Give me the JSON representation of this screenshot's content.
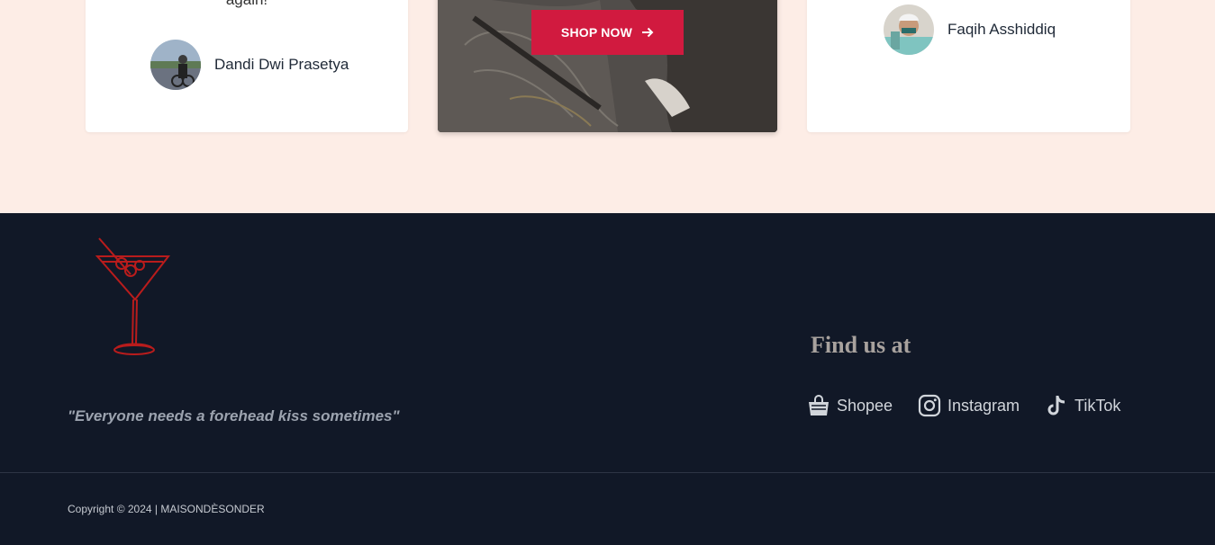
{
  "testimonials": {
    "left": {
      "text_tail": "again!",
      "author": "Dandi Dwi Prasetya"
    },
    "right": {
      "author": "Faqih Asshiddiq"
    }
  },
  "promo": {
    "button_label": "SHOP NOW"
  },
  "footer": {
    "tagline": "\"Everyone needs a forehead kiss sometimes\"",
    "find_us_title": "Find us at",
    "social": [
      {
        "label": "Shopee",
        "icon": "shopping-bag-icon"
      },
      {
        "label": "Instagram",
        "icon": "instagram-icon"
      },
      {
        "label": "TikTok",
        "icon": "tiktok-icon"
      }
    ],
    "copyright": "Copyright © 2024 | MAISONDÈSONDER"
  },
  "colors": {
    "top_background": "#fdede6",
    "footer_background": "#111827",
    "button_red": "#d11a3f",
    "logo_red": "#b91c1c"
  }
}
